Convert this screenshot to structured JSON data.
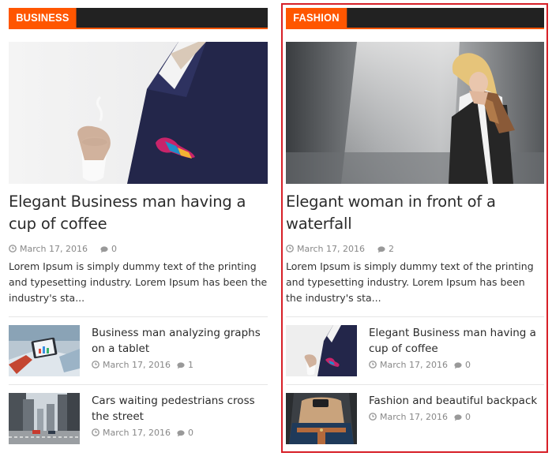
{
  "columns": [
    {
      "category": "BUSINESS",
      "featured": {
        "image": "businessman-with-coffee-photo",
        "title": "Elegant Business man having a cup of coffee",
        "date": "March 17, 2016",
        "comments": "0",
        "excerpt": "Lorem Ipsum is simply dummy text of the printing and typesetting industry. Lorem Ipsum has been the industry's sta..."
      },
      "items": [
        {
          "image": "tablet-graphs-photo",
          "title": "Business man analyzing graphs on a tablet",
          "date": "March 17, 2016",
          "comments": "1"
        },
        {
          "image": "city-street-cars-photo",
          "title": "Cars waiting pedestrians cross the street",
          "date": "March 17, 2016",
          "comments": "0"
        }
      ]
    },
    {
      "category": "FASHION",
      "featured": {
        "image": "woman-waterfall-photo",
        "title": "Elegant woman in front of a waterfall",
        "date": "March 17, 2016",
        "comments": "2",
        "excerpt": "Lorem Ipsum is simply dummy text of the printing and typesetting industry. Lorem Ipsum has been the industry's sta..."
      },
      "items": [
        {
          "image": "businessman-with-coffee-photo",
          "title": "Elegant Business man having a cup of coffee",
          "date": "March 17, 2016",
          "comments": "0"
        },
        {
          "image": "backpack-photo",
          "title": "Fashion and beautiful backpack",
          "date": "March 17, 2016",
          "comments": "0"
        }
      ]
    }
  ],
  "icons": {
    "date": "clock-icon",
    "comments": "comment-icon"
  },
  "colors": {
    "accent": "#ff5600",
    "bar": "#222222",
    "highlight": "#d71f27",
    "meta": "#888888"
  }
}
